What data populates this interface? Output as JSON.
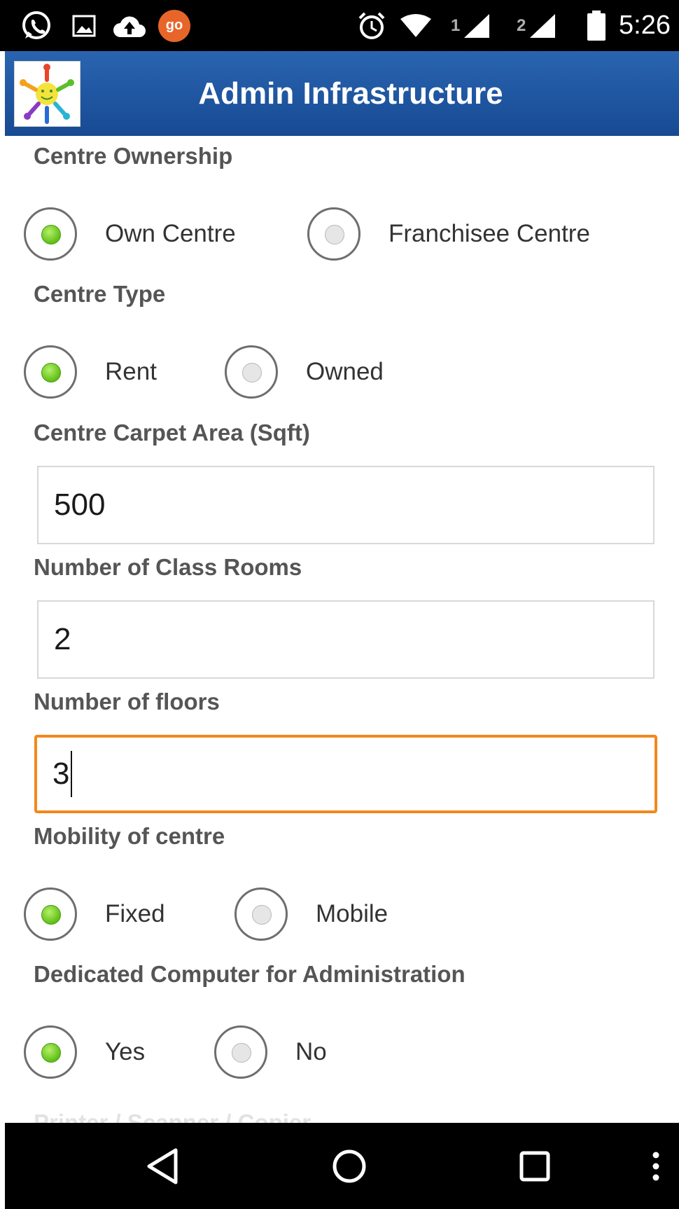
{
  "status_bar": {
    "icons": [
      "whatsapp-icon",
      "image-icon",
      "cloud-upload-icon",
      "go-launcher-icon",
      "alarm-icon",
      "wifi-icon",
      "signal-1-icon",
      "signal-2-icon",
      "battery-icon"
    ],
    "go_badge": "go",
    "sim1_label": "1",
    "sim2_label": "2",
    "time": "5:26"
  },
  "app_bar": {
    "title": "Admin Infrastructure",
    "colors": {
      "background": "#1f56a2"
    }
  },
  "form": {
    "centre_ownership": {
      "label": "Centre Ownership",
      "options": [
        "Own Centre",
        "Franchisee Centre"
      ],
      "selected": "Own Centre"
    },
    "centre_type": {
      "label": "Centre Type",
      "options": [
        "Rent",
        "Owned"
      ],
      "selected": "Rent"
    },
    "carpet_area": {
      "label": "Centre Carpet Area (Sqft)",
      "value": "500"
    },
    "class_rooms": {
      "label": "Number of Class Rooms",
      "value": "2"
    },
    "floors": {
      "label": "Number of floors",
      "value": "3",
      "focused": true
    },
    "mobility": {
      "label": "Mobility of centre",
      "options": [
        "Fixed",
        "Mobile"
      ],
      "selected": "Fixed"
    },
    "dedicated_computer": {
      "label": "Dedicated Computer for Administration",
      "options": [
        "Yes",
        "No"
      ],
      "selected": "Yes"
    },
    "next_section_partial": "Printer / Scanner / Copier"
  },
  "colors": {
    "radio_checked": "#6cc925",
    "focus_border": "#f2881c",
    "label_text": "#555555"
  },
  "nav_bar": {
    "buttons": [
      "back-icon",
      "home-icon",
      "recents-icon",
      "overflow-menu-icon"
    ]
  }
}
